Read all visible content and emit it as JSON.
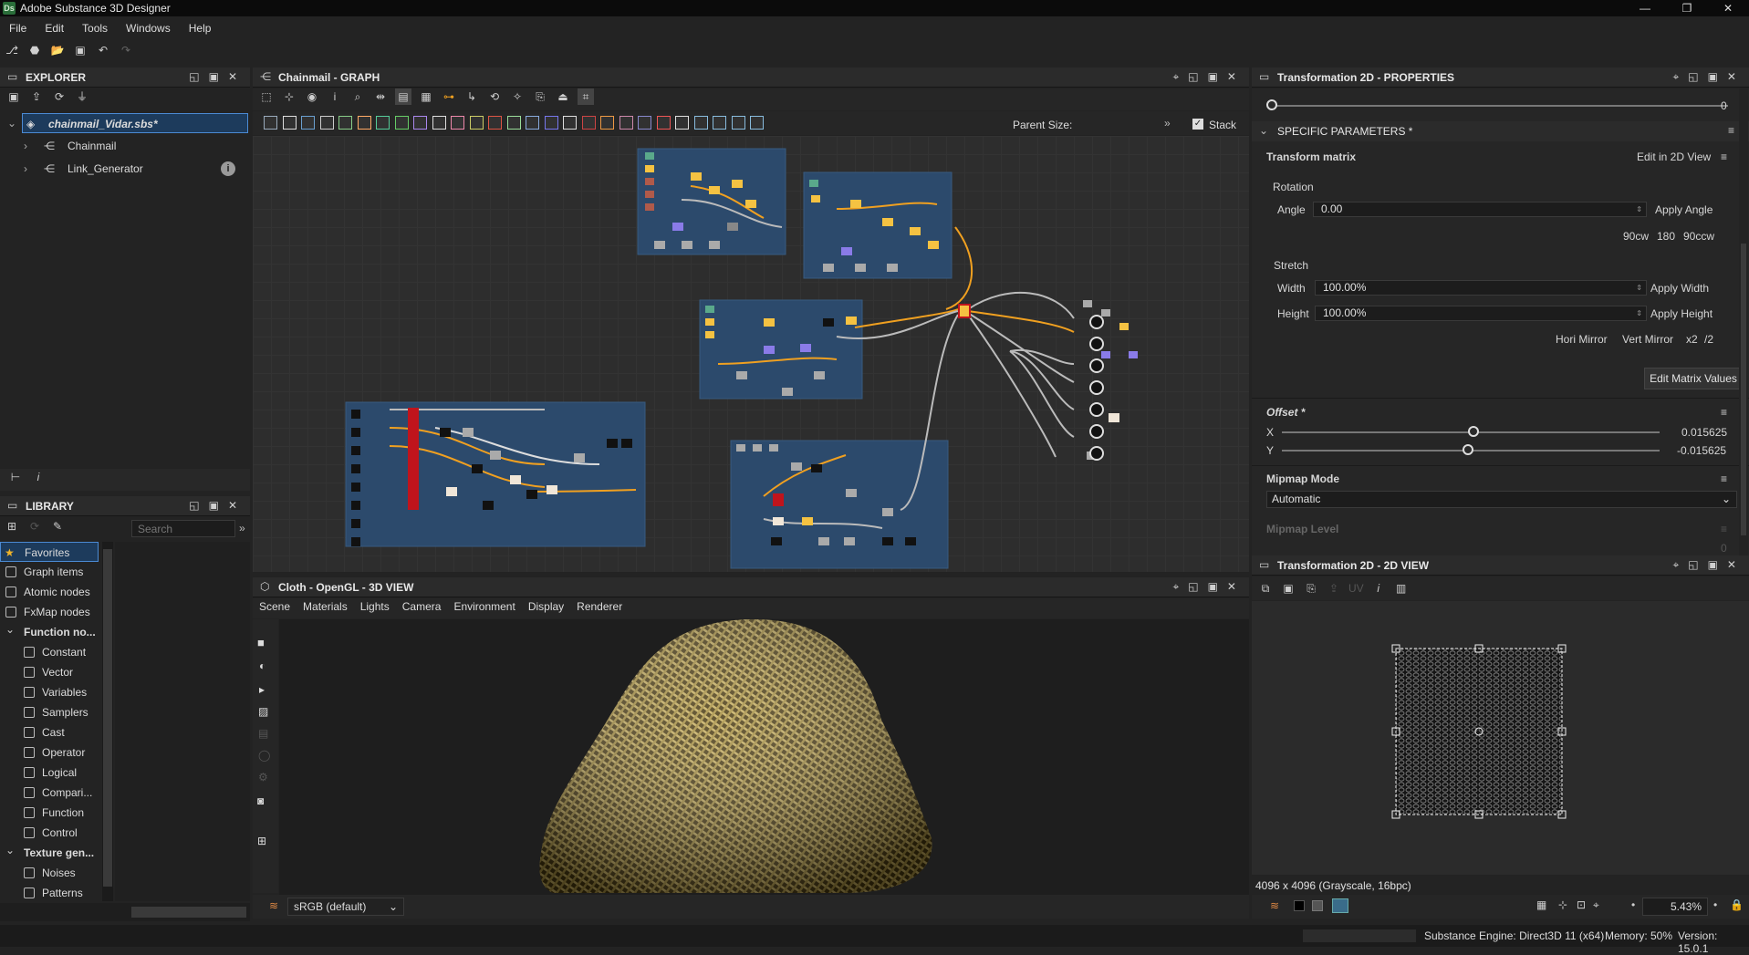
{
  "app": {
    "title": "Adobe Substance 3D Designer",
    "logo": "Ds"
  },
  "menu": [
    "File",
    "Edit",
    "Tools",
    "Windows",
    "Help"
  ],
  "explorer": {
    "title": "EXPLORER",
    "package": "chainmail_Vidar.sbs*",
    "items": [
      {
        "label": "Chainmail"
      },
      {
        "label": "Link_Generator"
      }
    ]
  },
  "library": {
    "title": "LIBRARY",
    "search_placeholder": "Search",
    "items": [
      {
        "label": "Favorites",
        "type": "star"
      },
      {
        "label": "Graph items"
      },
      {
        "label": "Atomic nodes"
      },
      {
        "label": "FxMap nodes"
      },
      {
        "label": "Function no...",
        "type": "group"
      },
      {
        "label": "Constant",
        "indent": true
      },
      {
        "label": "Vector",
        "indent": true
      },
      {
        "label": "Variables",
        "indent": true
      },
      {
        "label": "Samplers",
        "indent": true
      },
      {
        "label": "Cast",
        "indent": true
      },
      {
        "label": "Operator",
        "indent": true
      },
      {
        "label": "Logical",
        "indent": true
      },
      {
        "label": "Compari...",
        "indent": true
      },
      {
        "label": "Function",
        "indent": true
      },
      {
        "label": "Control",
        "indent": true
      },
      {
        "label": "Texture gen...",
        "type": "group"
      },
      {
        "label": "Noises",
        "indent": true
      },
      {
        "label": "Patterns",
        "indent": true
      }
    ]
  },
  "graph": {
    "title": "Chainmail - GRAPH",
    "parent_size_label": "Parent Size:",
    "stack_label": "Stack"
  },
  "view3d": {
    "title": "Cloth - OpenGL - 3D VIEW",
    "menu": [
      "Scene",
      "Materials",
      "Lights",
      "Camera",
      "Environment",
      "Display",
      "Renderer"
    ],
    "colorspace": "sRGB (default)"
  },
  "properties": {
    "title": "Transformation 2D - PROPERTIES",
    "random_seed_value": "0",
    "section_title": "SPECIFIC PARAMETERS *",
    "transform_matrix": "Transform matrix",
    "edit_in_2d": "Edit in 2D View",
    "rotation": "Rotation",
    "angle_label": "Angle",
    "angle_value": "0.00",
    "apply_angle": "Apply Angle",
    "rot_buttons": [
      "90cw",
      "180",
      "90ccw"
    ],
    "stretch": "Stretch",
    "width_label": "Width",
    "width_value": "100.00%",
    "apply_width": "Apply Width",
    "height_label": "Height",
    "height_value": "100.00%",
    "apply_height": "Apply Height",
    "mirror_buttons": [
      "Hori Mirror",
      "Vert Mirror",
      "x2",
      "/2"
    ],
    "edit_matrix": "Edit Matrix Values",
    "offset_title": "Offset *",
    "offset_x_label": "X",
    "offset_x_value": "0.015625",
    "offset_x_pos": 0.508,
    "offset_y_label": "Y",
    "offset_y_value": "-0.015625",
    "offset_y_pos": 0.492,
    "mipmap_mode_title": "Mipmap Mode",
    "mipmap_mode_value": "Automatic",
    "mipmap_level_title": "Mipmap Level",
    "mipmap_level_value": "0"
  },
  "view2d": {
    "title": "Transformation 2D - 2D VIEW",
    "uv_label": "UV",
    "resolution": "4096 x 4096 (Grayscale, 16bpc)",
    "zoom": "5.43%"
  },
  "status": {
    "engine": "Substance Engine: Direct3D 11 (x64)",
    "memory": "Memory: 50%",
    "version": "Version: 15.0.1"
  },
  "colors": {
    "accent": "#4b8ad3",
    "frame": "#2c4a6c",
    "wire": "#f0a020",
    "node_yellow": "#f5c242",
    "node_red": "#c0141c"
  }
}
